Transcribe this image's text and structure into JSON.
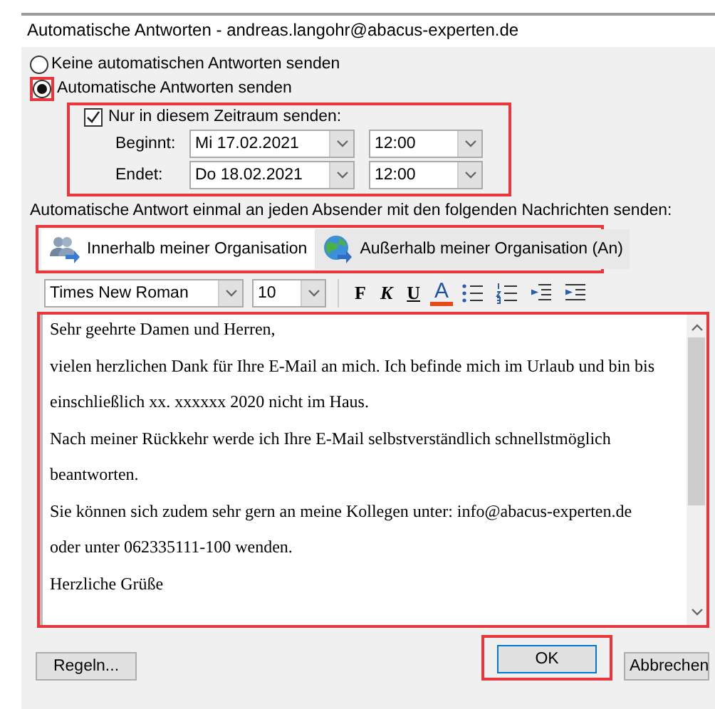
{
  "window": {
    "title": "Automatische Antworten - andreas.langohr@abacus-experten.de"
  },
  "options": [
    {
      "label": "Keine automatischen Antworten senden",
      "selected": false,
      "highlighted": false
    },
    {
      "label": "Automatische Antworten senden",
      "selected": true,
      "highlighted": true
    }
  ],
  "period": {
    "label": "Nur in diesem Zeitraum senden:",
    "checked": true,
    "highlighted": true,
    "rows": [
      {
        "label": "Beginnt:",
        "date": "Mi 17.02.2021",
        "time": "12:00"
      },
      {
        "label": "Endet:",
        "date": "Do 18.02.2021",
        "time": "12:00"
      }
    ]
  },
  "instruction": "Automatische Antwort einmal an jeden Absender mit den folgenden Nachrichten senden:",
  "tabs": {
    "highlighted": true,
    "items": [
      {
        "label": "Innerhalb meiner Organisation",
        "selected": true,
        "kind": "people"
      },
      {
        "label": "Außerhalb meiner Organisation (An)",
        "selected": false,
        "kind": "globe"
      }
    ]
  },
  "toolbar": {
    "font": "Times New Roman",
    "size": "10",
    "bold": "F",
    "italic": "K",
    "underline": "U",
    "font_color": "A"
  },
  "editor": {
    "highlighted": true,
    "lines": [
      "Sehr geehrte Damen und Herren,",
      "vielen herzlichen Dank für Ihre E-Mail an mich. Ich befinde mich im Urlaub und bin bis",
      "einschließlich xx. xxxxxx 2020 nicht im Haus.",
      "Nach meiner Rückkehr werde ich Ihre E-Mail selbstverständlich schnellstmöglich",
      "beantworten.",
      "Sie können sich zudem sehr gern an meine Kollegen unter: info@abacus-experten.de",
      "oder unter 062335111-100 wenden.",
      "Herzliche Grüße"
    ]
  },
  "buttons": [
    {
      "label": "Regeln...",
      "kind": "rules",
      "highlighted": false
    },
    {
      "label": "OK",
      "kind": "ok",
      "highlighted": true
    },
    {
      "label": "Abbrechen",
      "kind": "cancel",
      "highlighted": false
    }
  ]
}
